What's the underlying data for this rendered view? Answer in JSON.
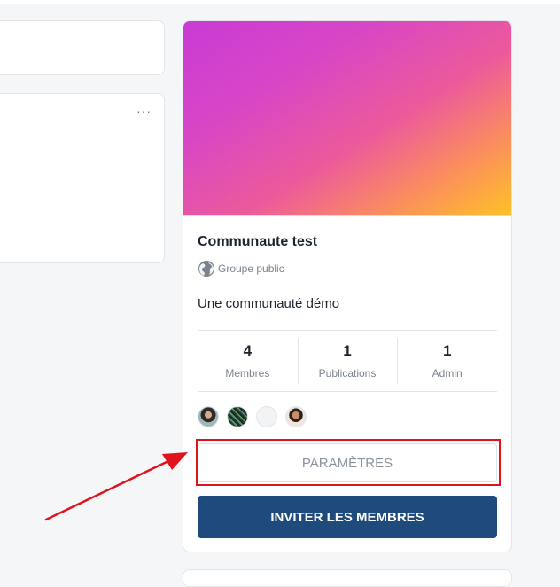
{
  "community": {
    "title": "Communaute test",
    "privacy_label": "Groupe public",
    "privacy_icon": "globe-icon",
    "description": "Une communauté démo",
    "cover_colors": [
      "#c93bd4",
      "#ec5a9b",
      "#ffc127"
    ],
    "stats": [
      {
        "value": "4",
        "label": "Membres"
      },
      {
        "value": "1",
        "label": "Publications"
      },
      {
        "value": "1",
        "label": "Admin"
      }
    ],
    "member_avatars": 4,
    "settings_button": "PARAMÈTRES",
    "invite_button": "INVITER LES MEMBRES"
  },
  "left_panel": {
    "more_menu": "···"
  },
  "annotation": {
    "highlight_color": "#e0121c"
  },
  "colors": {
    "primary": "#1f4b7c"
  }
}
